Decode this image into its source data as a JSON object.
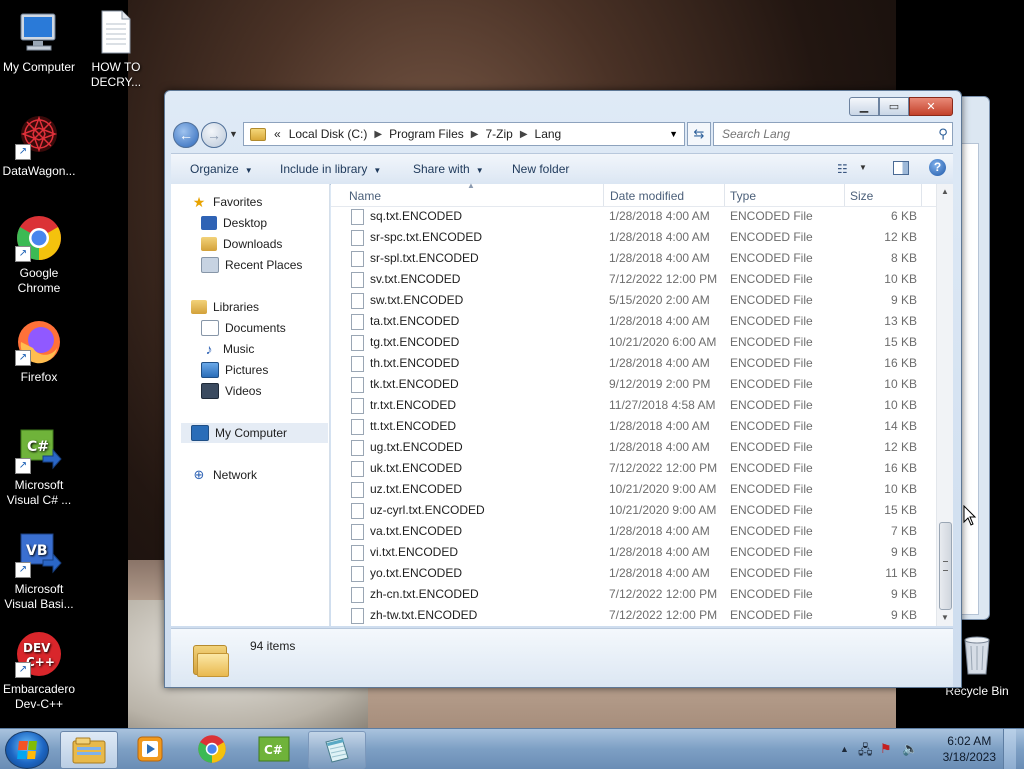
{
  "desktop": {
    "icons": [
      {
        "label": "My Computer",
        "icon": "computer-icon"
      },
      {
        "label": "HOW TO DECRY...",
        "icon": "text-document-icon"
      },
      {
        "label": "DataWagon...",
        "icon": "datawagon-icon"
      },
      {
        "label": "Google Chrome",
        "icon": "chrome-icon"
      },
      {
        "label": "Firefox",
        "icon": "firefox-icon"
      },
      {
        "label": "Microsoft Visual C# ...",
        "icon": "visual-csharp-icon"
      },
      {
        "label": "Microsoft Visual Basi...",
        "icon": "visual-basic-icon"
      },
      {
        "label": "Embarcadero Dev-C++",
        "icon": "devcpp-icon"
      },
      {
        "label": "Recycle Bin",
        "icon": "recycle-bin-icon"
      }
    ]
  },
  "window": {
    "caption": {
      "minimize": "▁",
      "maximize": "▭",
      "close": "✕"
    },
    "address": {
      "overflow": "«",
      "segments": [
        "Local Disk (C:)",
        "Program Files",
        "7-Zip",
        "Lang"
      ]
    },
    "search": {
      "placeholder": "Search Lang"
    },
    "toolbar": {
      "organize": "Organize",
      "include_in_library": "Include in library",
      "share_with": "Share with",
      "new_folder": "New folder"
    },
    "nav": {
      "favorites": "Favorites",
      "desktop": "Desktop",
      "downloads": "Downloads",
      "recent_places": "Recent Places",
      "libraries": "Libraries",
      "documents": "Documents",
      "music": "Music",
      "pictures": "Pictures",
      "videos": "Videos",
      "my_computer": "My Computer",
      "network": "Network"
    },
    "columns": {
      "name": "Name",
      "date": "Date modified",
      "type": "Type",
      "size": "Size"
    },
    "files": [
      {
        "name": "sq.txt.ENCODED",
        "date": "1/28/2018 4:00 AM",
        "type": "ENCODED File",
        "size": "6 KB"
      },
      {
        "name": "sr-spc.txt.ENCODED",
        "date": "1/28/2018 4:00 AM",
        "type": "ENCODED File",
        "size": "12 KB"
      },
      {
        "name": "sr-spl.txt.ENCODED",
        "date": "1/28/2018 4:00 AM",
        "type": "ENCODED File",
        "size": "8 KB"
      },
      {
        "name": "sv.txt.ENCODED",
        "date": "7/12/2022 12:00 PM",
        "type": "ENCODED File",
        "size": "10 KB"
      },
      {
        "name": "sw.txt.ENCODED",
        "date": "5/15/2020 2:00 AM",
        "type": "ENCODED File",
        "size": "9 KB"
      },
      {
        "name": "ta.txt.ENCODED",
        "date": "1/28/2018 4:00 AM",
        "type": "ENCODED File",
        "size": "13 KB"
      },
      {
        "name": "tg.txt.ENCODED",
        "date": "10/21/2020 6:00 AM",
        "type": "ENCODED File",
        "size": "15 KB"
      },
      {
        "name": "th.txt.ENCODED",
        "date": "1/28/2018 4:00 AM",
        "type": "ENCODED File",
        "size": "16 KB"
      },
      {
        "name": "tk.txt.ENCODED",
        "date": "9/12/2019 2:00 PM",
        "type": "ENCODED File",
        "size": "10 KB"
      },
      {
        "name": "tr.txt.ENCODED",
        "date": "11/27/2018 4:58 AM",
        "type": "ENCODED File",
        "size": "10 KB"
      },
      {
        "name": "tt.txt.ENCODED",
        "date": "1/28/2018 4:00 AM",
        "type": "ENCODED File",
        "size": "14 KB"
      },
      {
        "name": "ug.txt.ENCODED",
        "date": "1/28/2018 4:00 AM",
        "type": "ENCODED File",
        "size": "12 KB"
      },
      {
        "name": "uk.txt.ENCODED",
        "date": "7/12/2022 12:00 PM",
        "type": "ENCODED File",
        "size": "16 KB"
      },
      {
        "name": "uz.txt.ENCODED",
        "date": "10/21/2020 9:00 AM",
        "type": "ENCODED File",
        "size": "10 KB"
      },
      {
        "name": "uz-cyrl.txt.ENCODED",
        "date": "10/21/2020 9:00 AM",
        "type": "ENCODED File",
        "size": "15 KB"
      },
      {
        "name": "va.txt.ENCODED",
        "date": "1/28/2018 4:00 AM",
        "type": "ENCODED File",
        "size": "7 KB"
      },
      {
        "name": "vi.txt.ENCODED",
        "date": "1/28/2018 4:00 AM",
        "type": "ENCODED File",
        "size": "9 KB"
      },
      {
        "name": "yo.txt.ENCODED",
        "date": "1/28/2018 4:00 AM",
        "type": "ENCODED File",
        "size": "11 KB"
      },
      {
        "name": "zh-cn.txt.ENCODED",
        "date": "7/12/2022 12:00 PM",
        "type": "ENCODED File",
        "size": "9 KB"
      },
      {
        "name": "zh-tw.txt.ENCODED",
        "date": "7/12/2022 12:00 PM",
        "type": "ENCODED File",
        "size": "9 KB"
      }
    ],
    "details": {
      "item_count": "94 items"
    }
  },
  "taskbar": {
    "apps": [
      "windows-explorer-icon",
      "media-player-icon",
      "chrome-icon",
      "visual-csharp-icon",
      "notepad-icon"
    ],
    "clock": {
      "time": "6:02 AM",
      "date": "3/18/2023"
    }
  },
  "colors": {
    "accent": "#1d66c3",
    "explorer_bg": "#dfeaf6",
    "close_red": "#c3412a"
  }
}
